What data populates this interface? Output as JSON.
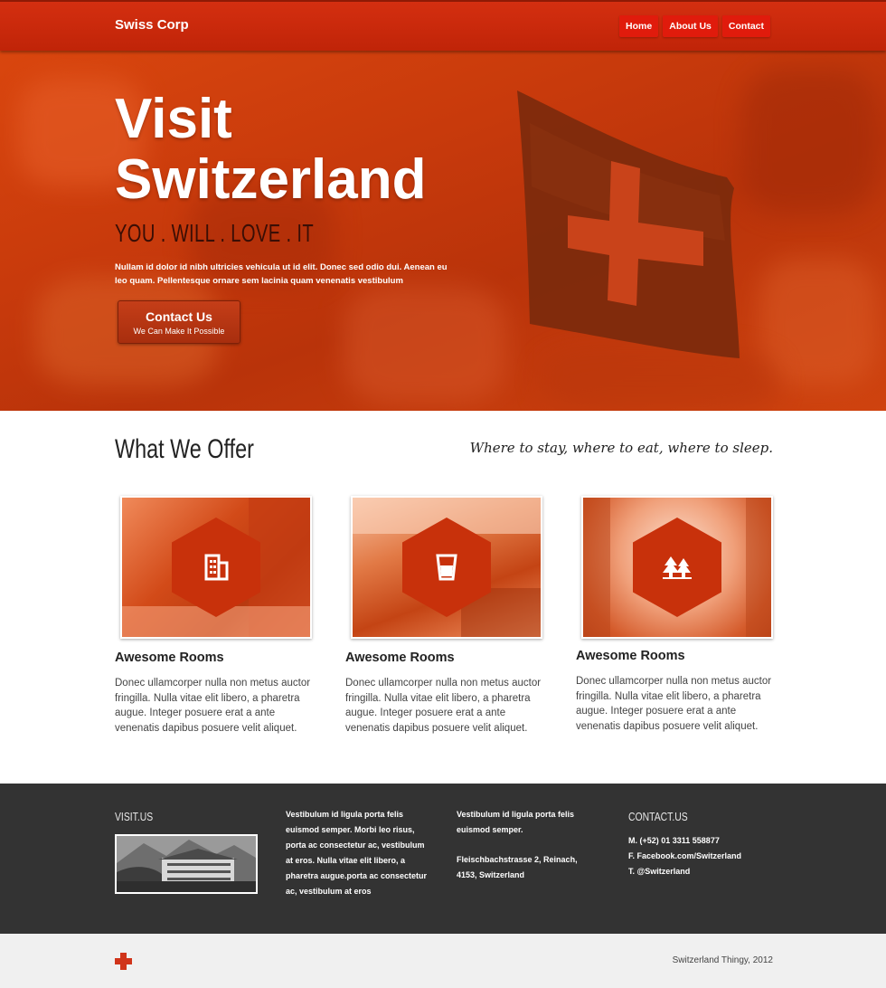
{
  "header": {
    "brand": "Swiss Corp",
    "nav": [
      "Home",
      "About Us",
      "Contact"
    ]
  },
  "hero": {
    "title_line1": "Visit",
    "title_line2": "Switzerland",
    "tagline": "YOU . WILL . LOVE . IT",
    "description": "Nullam id dolor id nibh ultricies vehicula ut id elit. Donec sed odio dui. Aenean eu leo quam. Pellentesque ornare sem lacinia quam venenatis vestibulum",
    "cta_main": "Contact Us",
    "cta_sub": "We Can Make It Possible"
  },
  "offer": {
    "title": "What We Offer",
    "subtitle": "Where to stay, where to eat, where to sleep.",
    "cards": [
      {
        "title": "Awesome Rooms",
        "icon": "building-icon",
        "text": "Donec ullamcorper nulla non metus auctor fringilla. Nulla vitae elit libero, a pharetra augue. Integer posuere erat a ante venenatis dapibus posuere velit aliquet."
      },
      {
        "title": "Awesome Rooms",
        "icon": "glass-icon",
        "text": "Donec ullamcorper nulla non metus auctor fringilla. Nulla vitae elit libero, a pharetra augue. Integer posuere erat a ante venenatis dapibus posuere velit aliquet."
      },
      {
        "title": "Awesome Rooms",
        "icon": "trees-icon",
        "text": "Donec ullamcorper nulla non metus auctor fringilla. Nulla vitae elit libero, a pharetra augue. Integer posuere erat a ante venenatis dapibus posuere velit aliquet."
      }
    ]
  },
  "footer": {
    "visit_heading": "VISIT.US",
    "col2_text": "Vestibulum id ligula porta felis euismod semper. Morbi leo risus, porta ac consectetur ac, vestibulum at eros. Nulla vitae elit libero, a pharetra augue.porta ac consectetur ac, vestibulum at eros",
    "col3_text": "Vestibulum id ligula porta felis euismod semper.",
    "col3_address_line1": "Fleischbachstrasse 2, Reinach,",
    "col3_address_line2": "4153, Switzerland",
    "contact_heading": "CONTACT.US",
    "contact_phone": "M. (+52) 01 3311 558877",
    "contact_facebook": "F. Facebook.com/Switzerland",
    "contact_twitter": "T. @Switzerland"
  },
  "bottom": {
    "copyright": "Switzerland Thingy, 2012"
  },
  "colors": {
    "primary_red": "#c8310b",
    "nav_red": "#e01b0c",
    "footer_dark": "#333333"
  }
}
